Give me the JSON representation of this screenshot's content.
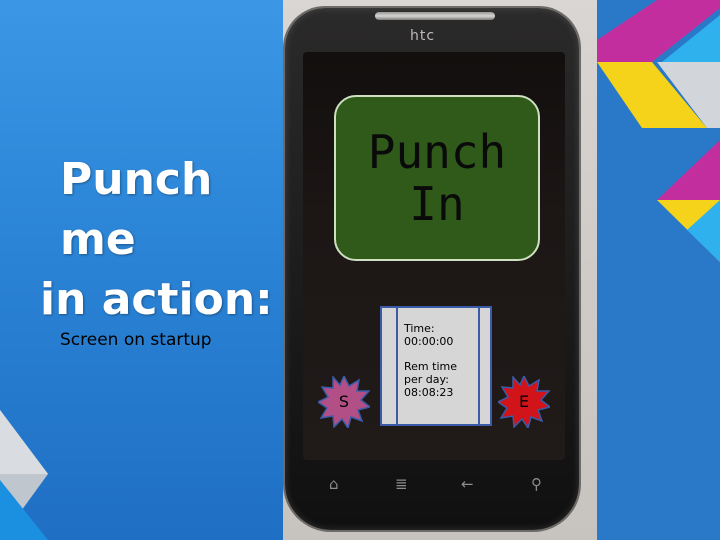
{
  "slide": {
    "title_line1": "Punch me",
    "title_line2": "in action:",
    "caption": "Screen on startup"
  },
  "phone": {
    "brand": "htc",
    "punch_button": {
      "line1": "Punch",
      "line2": "In",
      "color": "#2f5a1a"
    },
    "info": {
      "time_label": "Time:",
      "time_value": "00:00:00",
      "rem_label_1": "Rem time",
      "rem_label_2": "per day:",
      "rem_value": "08:08:23"
    },
    "start_badge": {
      "label": "S",
      "color": "#b24f86"
    },
    "end_badge": {
      "label": "E",
      "color": "#d1131a"
    },
    "nav_icons": [
      "home-icon",
      "menu-icon",
      "back-icon",
      "search-icon"
    ]
  },
  "colors": {
    "background": "#2d86d8",
    "accent_magenta": "#c22e9e",
    "accent_yellow": "#f4d31a",
    "accent_cyan": "#22a7e6"
  }
}
